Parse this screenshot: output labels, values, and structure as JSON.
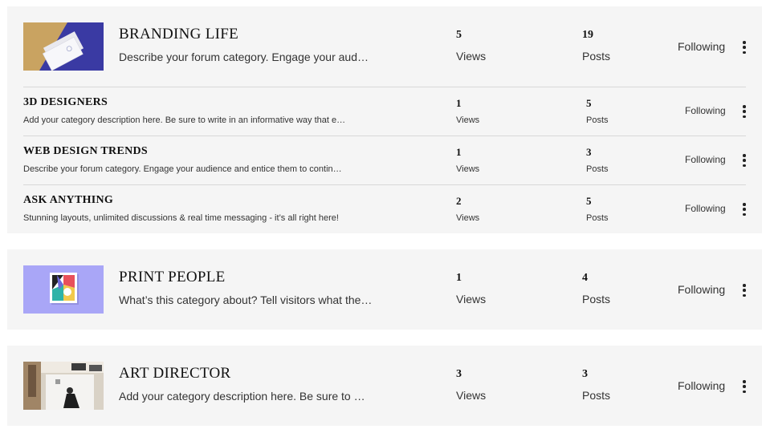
{
  "categories": [
    {
      "title": "BRANDING LIFE",
      "description": "Describe your forum category. Engage your aud…",
      "views": "5",
      "views_label": "Views",
      "posts": "19",
      "posts_label": "Posts",
      "follow_label": "Following",
      "subcategories": [
        {
          "title": "3D DESIGNERS",
          "description": "Add your category description here. Be sure to write in an informative way that e…",
          "views": "1",
          "views_label": "Views",
          "posts": "5",
          "posts_label": "Posts",
          "follow_label": "Following"
        },
        {
          "title": "WEB DESIGN TRENDS",
          "description": "Describe your forum category. Engage your audience and entice them to contin…",
          "views": "1",
          "views_label": "Views",
          "posts": "3",
          "posts_label": "Posts",
          "follow_label": "Following"
        },
        {
          "title": "ASK ANYTHING",
          "description": "Stunning layouts, unlimited discussions & real time messaging - it’s all right here!",
          "views": "2",
          "views_label": "Views",
          "posts": "5",
          "posts_label": "Posts",
          "follow_label": "Following"
        }
      ]
    },
    {
      "title": "PRINT PEOPLE",
      "description": "What’s this category about? Tell visitors what the…",
      "views": "1",
      "views_label": "Views",
      "posts": "4",
      "posts_label": "Posts",
      "follow_label": "Following"
    },
    {
      "title": "ART DIRECTOR",
      "description": "Add your category description here. Be sure to …",
      "views": "3",
      "views_label": "Views",
      "posts": "3",
      "posts_label": "Posts",
      "follow_label": "Following"
    }
  ],
  "icons": {
    "menu": "more-vertical-icon"
  },
  "colors": {
    "card_bg": "#f5f5f5",
    "divider": "#d8d8d8",
    "print_thumb_bg": "#a9a6f7",
    "branding_thumb_blue": "#3a3aa3",
    "branding_thumb_tan": "#c9a361"
  }
}
